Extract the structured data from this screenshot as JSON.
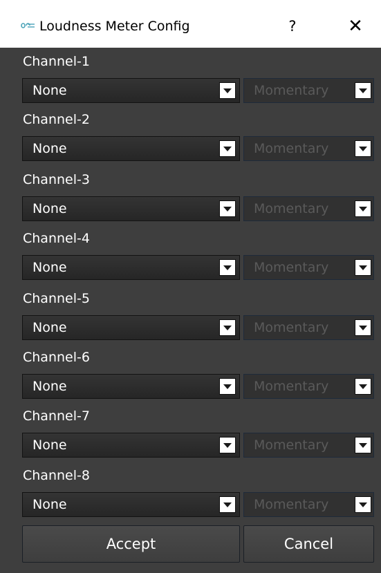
{
  "window": {
    "title": "Loudness Meter Config",
    "help_label": "?",
    "close_label": "✕",
    "icon_name": "app-logo-icon"
  },
  "channels": [
    {
      "label": "Channel-1",
      "source": "None",
      "mode": "Momentary"
    },
    {
      "label": "Channel-2",
      "source": "None",
      "mode": "Momentary"
    },
    {
      "label": "Channel-3",
      "source": "None",
      "mode": "Momentary"
    },
    {
      "label": "Channel-4",
      "source": "None",
      "mode": "Momentary"
    },
    {
      "label": "Channel-5",
      "source": "None",
      "mode": "Momentary"
    },
    {
      "label": "Channel-6",
      "source": "None",
      "mode": "Momentary"
    },
    {
      "label": "Channel-7",
      "source": "None",
      "mode": "Momentary"
    },
    {
      "label": "Channel-8",
      "source": "None",
      "mode": "Momentary"
    }
  ],
  "buttons": {
    "accept_label": "Accept",
    "cancel_label": "Cancel"
  },
  "colors": {
    "background": "#3e3e3e",
    "titlebar": "#ffffff",
    "disabled_text": "#5a5a5a",
    "logo_accent": "#4aa3b8"
  }
}
